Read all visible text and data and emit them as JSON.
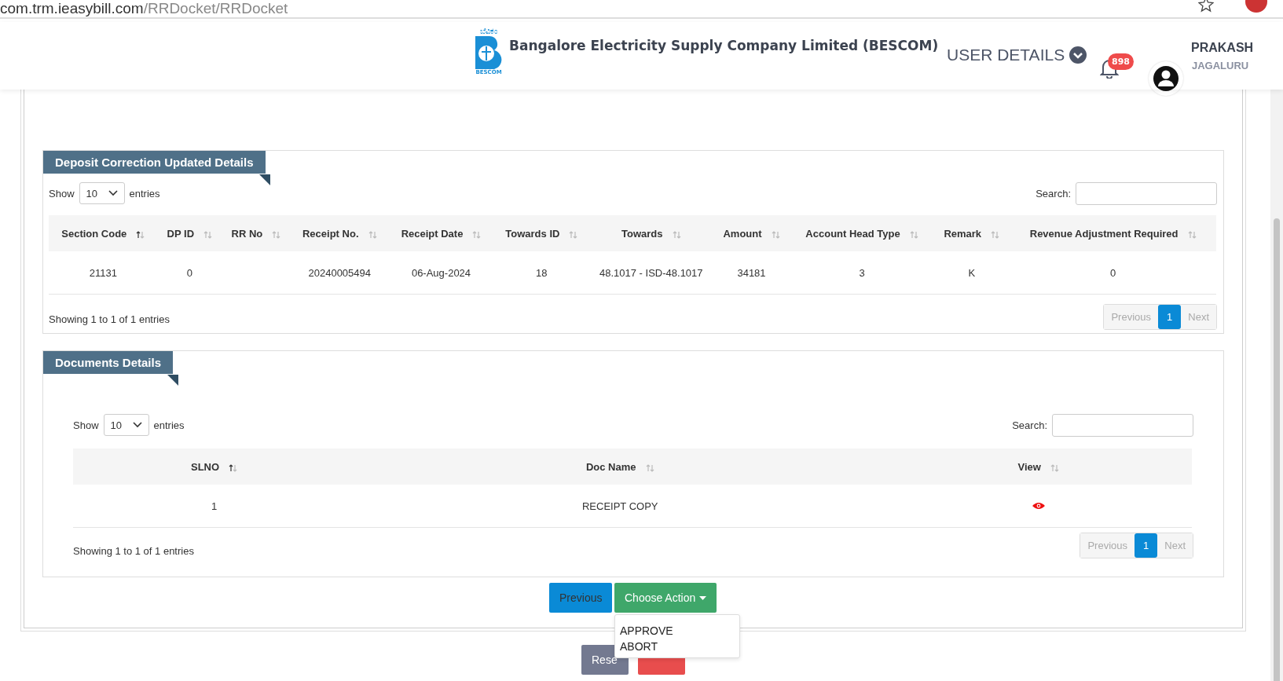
{
  "browser": {
    "address_host": "com.trm.ieasybill.com",
    "address_path": "/RRDocket/RRDocket"
  },
  "header": {
    "company": "Bangalore Electricity Supply Company Limited (BESCOM)",
    "logo_top": "ಬೆವಿಕಂ",
    "logo_bottom": "BESCOM",
    "user_details": "USER DETAILS",
    "notification_count": "898",
    "user_name": "PRAKASH",
    "user_location": "JAGALURU"
  },
  "deposit_section": {
    "title": "Deposit Correction Updated Details",
    "show_label": "Show",
    "entries_value": "10",
    "entries_label": "entries",
    "search_label": "Search:",
    "columns": [
      {
        "label": "Section Code",
        "sorted": true
      },
      {
        "label": "DP ID",
        "sorted": false
      },
      {
        "label": "RR No",
        "sorted": false
      },
      {
        "label": "Receipt No.",
        "sorted": false
      },
      {
        "label": "Receipt Date",
        "sorted": false
      },
      {
        "label": "Towards ID",
        "sorted": false
      },
      {
        "label": "Towards",
        "sorted": false
      },
      {
        "label": "Amount",
        "sorted": false
      },
      {
        "label": "Account Head Type",
        "sorted": false
      },
      {
        "label": "Remark",
        "sorted": false
      },
      {
        "label": "Revenue Adjustment Required",
        "sorted": false
      }
    ],
    "rows": [
      [
        "21131",
        "0",
        "",
        "20240005494",
        "06-Aug-2024",
        "18",
        "48.1017 - ISD-48.1017",
        "34181",
        "3",
        "K",
        "0"
      ]
    ],
    "info": "Showing 1 to 1 of 1 entries",
    "pagination": {
      "previous": "Previous",
      "page": "1",
      "next": "Next"
    }
  },
  "documents_section": {
    "title": "Documents Details",
    "show_label": "Show",
    "entries_value": "10",
    "entries_label": "entries",
    "search_label": "Search:",
    "columns": [
      {
        "label": "SLNO",
        "sorted": true
      },
      {
        "label": "Doc Name",
        "sorted": false
      },
      {
        "label": "View",
        "sorted": false
      }
    ],
    "rows": [
      [
        "1",
        "RECEIPT COPY"
      ]
    ],
    "info": "Showing 1 to 1 of 1 entries",
    "pagination": {
      "previous": "Previous",
      "page": "1",
      "next": "Next"
    }
  },
  "actions": {
    "previous": "Previous",
    "choose_action": "Choose Action",
    "menu": [
      "APPROVE",
      "ABORT"
    ],
    "reset": "Rese"
  }
}
